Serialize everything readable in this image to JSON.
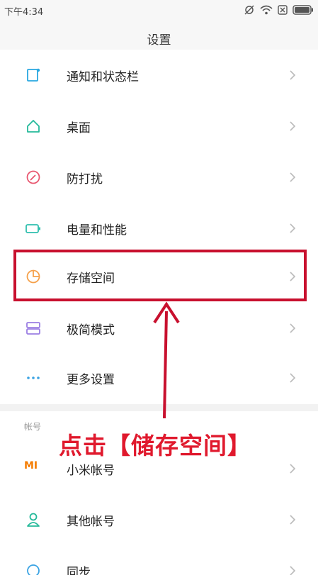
{
  "status_bar": {
    "time": "下午4:34"
  },
  "header": {
    "title": "设置"
  },
  "settings": {
    "items": [
      {
        "label": "通知和状态栏",
        "icon": "notification-icon",
        "color": "#29a8e0"
      },
      {
        "label": "桌面",
        "icon": "home-icon",
        "color": "#25b99a"
      },
      {
        "label": "防打扰",
        "icon": "do-not-disturb-icon",
        "color": "#e8566f"
      },
      {
        "label": "电量和性能",
        "icon": "battery-icon",
        "color": "#2fbfae"
      },
      {
        "label": "存储空间",
        "icon": "storage-pie-icon",
        "color": "#f5a04a"
      },
      {
        "label": "极简模式",
        "icon": "simple-mode-icon",
        "color": "#9b7ee3"
      },
      {
        "label": "更多设置",
        "icon": "more-icon",
        "color": "#3aa3e3"
      }
    ]
  },
  "accounts": {
    "title": "帐号",
    "items": [
      {
        "label": "小米帐号",
        "icon": "mi-logo-icon",
        "icon_text": "MI",
        "color": "#f57c00"
      },
      {
        "label": "其他帐号",
        "icon": "person-icon",
        "color": "#25b99a"
      },
      {
        "label": "同步",
        "icon": "sync-icon",
        "color": "#3aa3e3"
      }
    ]
  },
  "annotation": {
    "text": "点击【储存空间】",
    "color": "#e0192d",
    "highlighted_item": "存储空间"
  }
}
